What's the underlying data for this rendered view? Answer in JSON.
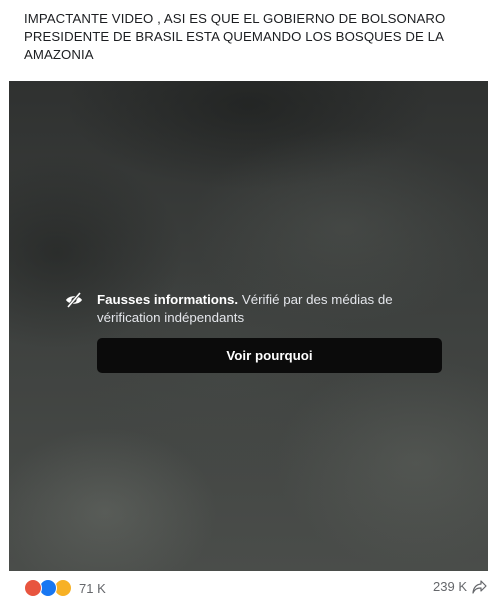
{
  "post": {
    "caption_lines": [
      "IMPACTANTE VIDEO , ASI ES QUE EL GOBIERNO DE BOLSONARO",
      "PRESIDENTE DE BRASIL ESTA QUEMANDO LOS BOSQUES DE LA",
      "AMAZONIA"
    ]
  },
  "warning": {
    "icon": "hidden-eye-icon",
    "title": "Fausses informations.",
    "description": " Vérifié par des médias de vérification indépendants",
    "button_label": "Voir pourquoi"
  },
  "footer": {
    "reaction_icons": [
      "angry-reaction-icon",
      "like-reaction-icon",
      "wow-reaction-icon"
    ],
    "reactions_count": "71 K",
    "shares_count": "239 K",
    "share_icon": "share-icon"
  },
  "colors": {
    "overlay_background": "#3a3c3b",
    "button_background": "#0b0b0b",
    "like": "#1877f2",
    "angry": "#e8553f",
    "wow": "#f7b125"
  }
}
